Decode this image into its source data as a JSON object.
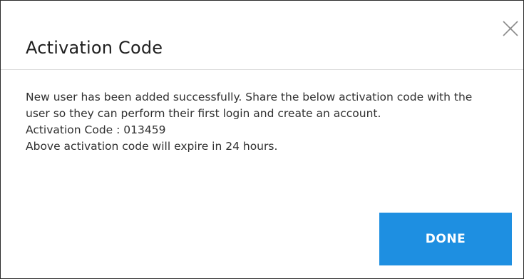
{
  "dialog": {
    "title": "Activation Code",
    "close_icon": "close-icon",
    "message": "New user has been added successfully. Share the below activation code with the user so they can perform their first login and create an account.",
    "code_label": "Activation Code : ",
    "code_value": "013459",
    "expiry_note": "Above activation code will expire in 24 hours.",
    "done_label": "DONE",
    "accent_color": "#1e8fe1"
  }
}
